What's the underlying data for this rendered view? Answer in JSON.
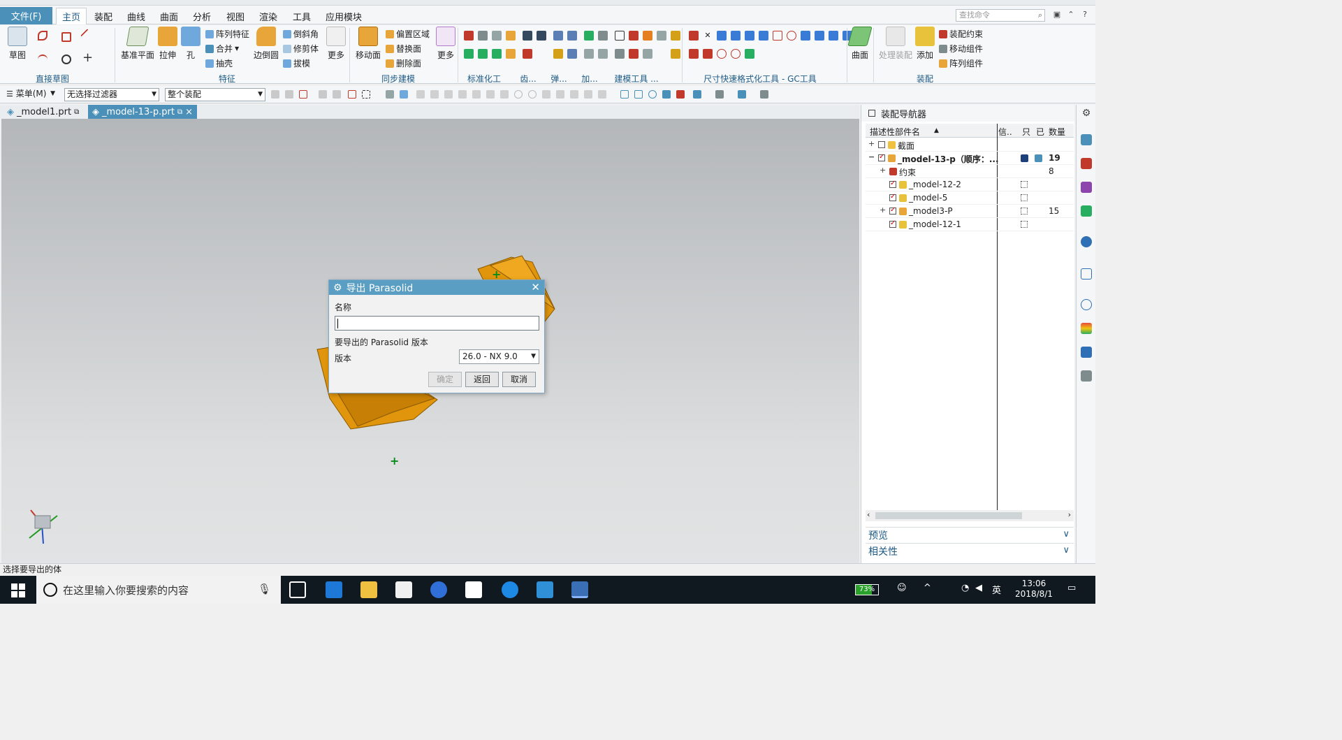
{
  "menu": {
    "file_label": "文件(F)",
    "tabs": [
      "主页",
      "装配",
      "曲线",
      "曲面",
      "分析",
      "视图",
      "渲染",
      "工具",
      "应用模块"
    ],
    "search_placeholder": "查找命令"
  },
  "ribbon": {
    "sketch_label": "草图",
    "group_direct_sketch": "直接草图",
    "datum_plane": "基准平面",
    "extrude": "拉伸",
    "hole": "孔",
    "pattern_feature": "阵列特征",
    "unite": "合并",
    "shell": "抽壳",
    "edge_blend": "边倒圆",
    "chamfer": "倒斜角",
    "trim_body": "修剪体",
    "draft": "拔模",
    "more": "更多",
    "group_feature": "特征",
    "move_face": "移动面",
    "offset_region": "偏置区域",
    "replace_face": "替换面",
    "delete_face": "删除面",
    "more2": "更多",
    "group_sync": "同步建模",
    "group_std": "标准化工具...",
    "group_gear": "齿...",
    "group_spring": "弹...",
    "group_add": "加...",
    "group_model_tools": "建模工具 ...",
    "group_gc": "尺寸快速格式化工具 - GC工具箱",
    "surface": "曲面",
    "process_assembly": "处理装配",
    "add": "添加",
    "assembly_constraint": "装配约束",
    "move_component": "移动组件",
    "pattern_component": "阵列组件",
    "group_assembly": "装配"
  },
  "toolbar2": {
    "menu_label": "菜单(M)",
    "filter_value": "无选择过滤器",
    "scope_value": "整个装配"
  },
  "doc_tabs": [
    "_model1.prt",
    "_model-13-p.prt"
  ],
  "dialog": {
    "title": "导出 Parasolid",
    "name_label": "名称",
    "name_value": "",
    "version_section": "要导出的 Parasolid 版本",
    "version_label": "版本",
    "version_value": "26.0 - NX 9.0",
    "ok": "确定",
    "back": "返回",
    "cancel": "取消"
  },
  "navigator": {
    "title": "装配导航器",
    "col_name": "描述性部件名",
    "col_info": "信..",
    "col_ro": "只",
    "col_mod": "已",
    "col_qty": "数量",
    "rows": [
      {
        "name": "截面",
        "qty": ""
      },
      {
        "name": "_model-13-p（顺序：...",
        "qty": "19"
      },
      {
        "name": "约束",
        "qty": "8"
      },
      {
        "name": "_model-12-2",
        "qty": ""
      },
      {
        "name": "_model-5",
        "qty": ""
      },
      {
        "name": "_model3-P",
        "qty": "15"
      },
      {
        "name": "_model-12-1",
        "qty": ""
      }
    ],
    "preview": "预览",
    "related": "相关性"
  },
  "status_text": "选择要导出的体",
  "taskbar": {
    "search_text": "在这里输入你要搜索的内容",
    "battery": "73%",
    "battery_level": 0.73,
    "ime": "英",
    "time": "13:06",
    "date": "2018/8/1"
  },
  "colors": {
    "accent": "#4a90b8",
    "model_orange": "#e0950c",
    "check_red": "#cc0000"
  }
}
